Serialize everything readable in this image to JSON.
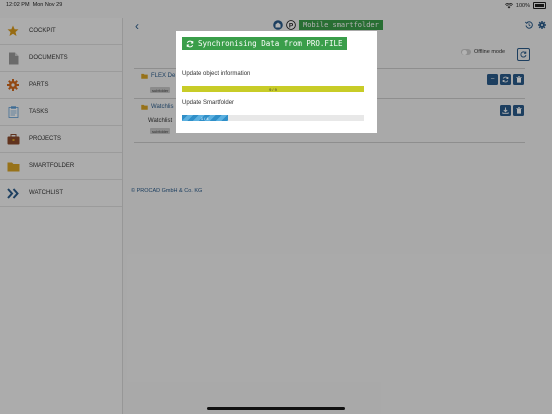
{
  "status": {
    "time": "12:02 PM",
    "date": "Mon Nov 29",
    "battery": "100%"
  },
  "sidebar": {
    "items": [
      {
        "label": "COCKPIT",
        "icon": "star-icon",
        "color": "#d99a1a"
      },
      {
        "label": "DOCUMENTS",
        "icon": "document-icon",
        "color": "#888888"
      },
      {
        "label": "PARTS",
        "icon": "gear-icon",
        "color": "#d2691e"
      },
      {
        "label": "TASKS",
        "icon": "clipboard-icon",
        "color": "#5a9bd5"
      },
      {
        "label": "PROJECTS",
        "icon": "briefcase-icon",
        "color": "#8b4a2b"
      },
      {
        "label": "SMARTFOLDER",
        "icon": "folder-icon",
        "color": "#d8a425"
      },
      {
        "label": "WATCHLIST",
        "icon": "double-chevron-icon",
        "color": "#2a5b8a"
      }
    ]
  },
  "header": {
    "title": "Mobile smartfolder"
  },
  "content": {
    "offline_label": "Offline mode",
    "rows": [
      {
        "title": "FLEX De",
        "tag": "subfolder"
      },
      {
        "title": "Watchlis",
        "subtitle": "Watchlist",
        "tag": "subfolder"
      }
    ],
    "footer": "© PROCAD GmbH & Co. KG"
  },
  "dialog": {
    "title": "Synchronising Data from PRO.FILE",
    "tasks": [
      {
        "label": "Update object information",
        "progress_text": "9 / 9",
        "progress": 1.0
      },
      {
        "label": "Update Smartfolder",
        "progress_text": "1 / 4",
        "progress": 0.25
      }
    ]
  },
  "colors": {
    "accent": "#2a5b8a",
    "brand_green": "#3a9e4a",
    "progress_done": "#c8cc27",
    "progress_active": "#2f8fc8"
  }
}
